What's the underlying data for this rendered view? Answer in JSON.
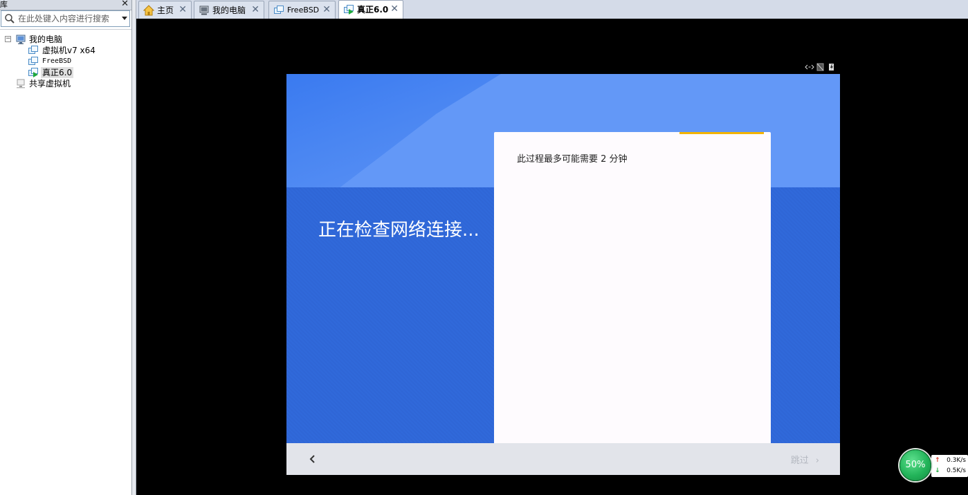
{
  "library": {
    "title": "库",
    "close_glyph": "✕",
    "search_placeholder": "在此处键入内容进行搜索",
    "tree": {
      "my_computer": "我的电脑",
      "toggle": "−",
      "vms": [
        "虚拟机v7 x64",
        "FreeBSD",
        "真正6.0"
      ],
      "shared": "共享虚拟机"
    }
  },
  "tabs": [
    {
      "label": "主页",
      "icon": "home-icon"
    },
    {
      "label": "我的电脑",
      "icon": "computer-icon"
    },
    {
      "label": "FreeBSD",
      "icon": "vm-icon"
    },
    {
      "label": "真正6.0",
      "icon": "vm-running-icon",
      "active": true
    }
  ],
  "tab_close_glyph": "✕",
  "vm": {
    "headline": "正在检查网络连接...",
    "card_text": "此过程最多可能需要 2 分钟",
    "skip_label": "跳过",
    "skip_chevron": "›",
    "back_chevron": "‹"
  },
  "network": {
    "percent": "50%",
    "upload": "0.3K/s",
    "download": "0.5K/s",
    "up_arrow": "↑",
    "down_arrow": "↓"
  },
  "colors": {
    "hero_light": "#6398f7",
    "hero_dark": "#3068d8",
    "progress": "#f4b400",
    "running_green": "#1fa83c"
  }
}
